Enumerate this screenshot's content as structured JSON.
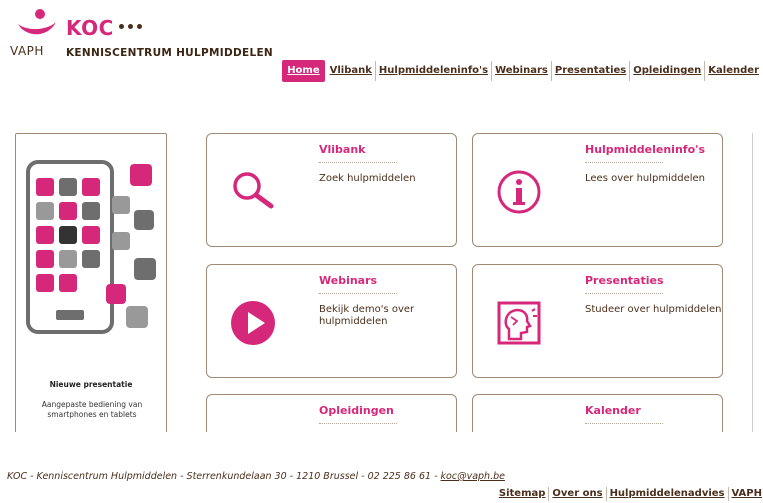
{
  "logo": {
    "koc": "KOC",
    "vaph": "VAPH",
    "subtitle": "KENNISCENTRUM HULPMIDDELEN",
    "brand_color": "#d6287b"
  },
  "topnav": [
    "Home",
    "Vlibank",
    "Hulpmiddeleninfo's",
    "Webinars",
    "Presentaties",
    "Opleidingen",
    "Kalender"
  ],
  "active_nav": "Home",
  "promo": {
    "title": "Nieuwe presentatie",
    "text": "Aangepaste bediening van smartphones en tablets"
  },
  "tiles": [
    {
      "title": "Vlibank",
      "desc": "Zoek hulpmiddelen",
      "icon": "magnifier-icon"
    },
    {
      "title": "Hulpmiddeleninfo's",
      "desc": "Lees over hulpmiddelen",
      "icon": "info-icon"
    },
    {
      "title": "Webinars",
      "desc": "Bekijk demo's over hulpmiddelen",
      "icon": "play-icon"
    },
    {
      "title": "Presentaties",
      "desc": "Studeer over hulpmiddelen",
      "icon": "head-profile-icon"
    },
    {
      "title": "Opleidingen",
      "desc": "",
      "icon": "training-icon"
    },
    {
      "title": "Kalender",
      "desc": "",
      "icon": "calendar-icon"
    }
  ],
  "footer": {
    "address": "KOC - Kenniscentrum Hulpmiddelen - Sterrenkundelaan 30 - 1210 Brussel - 02 225 86 61 - ",
    "email": "koc@vaph.be",
    "links": [
      "Sitemap",
      "Over ons",
      "Hulpmiddelenadvies",
      "VAPH"
    ]
  }
}
